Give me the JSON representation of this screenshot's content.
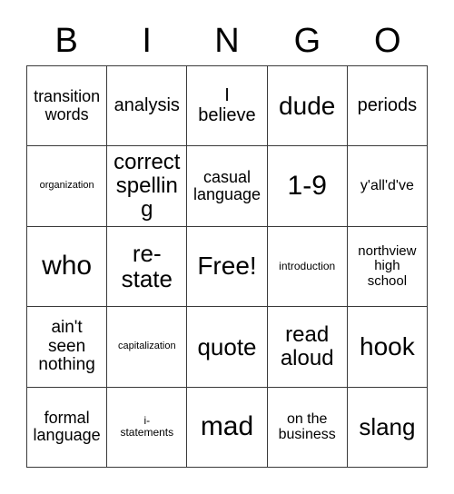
{
  "card": {
    "title": "BINGO",
    "headers": [
      "B",
      "I",
      "N",
      "G",
      "O"
    ],
    "free_space_label": "Free!",
    "border_color": "#3a3a3a",
    "background_color": "#ffffff",
    "text_color": "#000000",
    "grid_size": "5x5",
    "rows": [
      [
        {
          "label": "transition\nwords",
          "size": "fs-m"
        },
        {
          "label": "analysis",
          "size": "fs-l"
        },
        {
          "label": "I\nbelieve",
          "size": "fs-l"
        },
        {
          "label": "dude",
          "size": "fs-h1"
        },
        {
          "label": "periods",
          "size": "fs-l"
        }
      ],
      [
        {
          "label": "organization",
          "size": "fs-xxs"
        },
        {
          "label": "correct\nspelling",
          "size": "fs-xl"
        },
        {
          "label": "casual\nlanguage",
          "size": "fs-m"
        },
        {
          "label": "1-9",
          "size": "fs-h2"
        },
        {
          "label": "y'all'd've",
          "size": "fs-sm"
        }
      ],
      [
        {
          "label": "who",
          "size": "fs-h2"
        },
        {
          "label": "re-\nstate",
          "size": "fs-xxl"
        },
        {
          "label": "Free!",
          "size": "fs-h1"
        },
        {
          "label": "introduction",
          "size": "fs-xs"
        },
        {
          "label": "northview\nhigh\nschool",
          "size": "fs-s"
        }
      ],
      [
        {
          "label": "ain't\nseen\nnothing",
          "size": "fs-ml"
        },
        {
          "label": "capitalization",
          "size": "fs-xxs"
        },
        {
          "label": "quote",
          "size": "fs-xxl"
        },
        {
          "label": "read\naloud",
          "size": "fs-xl"
        },
        {
          "label": "hook",
          "size": "fs-h1"
        }
      ],
      [
        {
          "label": "formal\nlanguage",
          "size": "fs-m"
        },
        {
          "label": "i-\nstatements",
          "size": "fs-xs"
        },
        {
          "label": "mad",
          "size": "fs-h2"
        },
        {
          "label": "on the\nbusiness",
          "size": "fs-sm"
        },
        {
          "label": "slang",
          "size": "fs-xxl"
        }
      ]
    ]
  }
}
